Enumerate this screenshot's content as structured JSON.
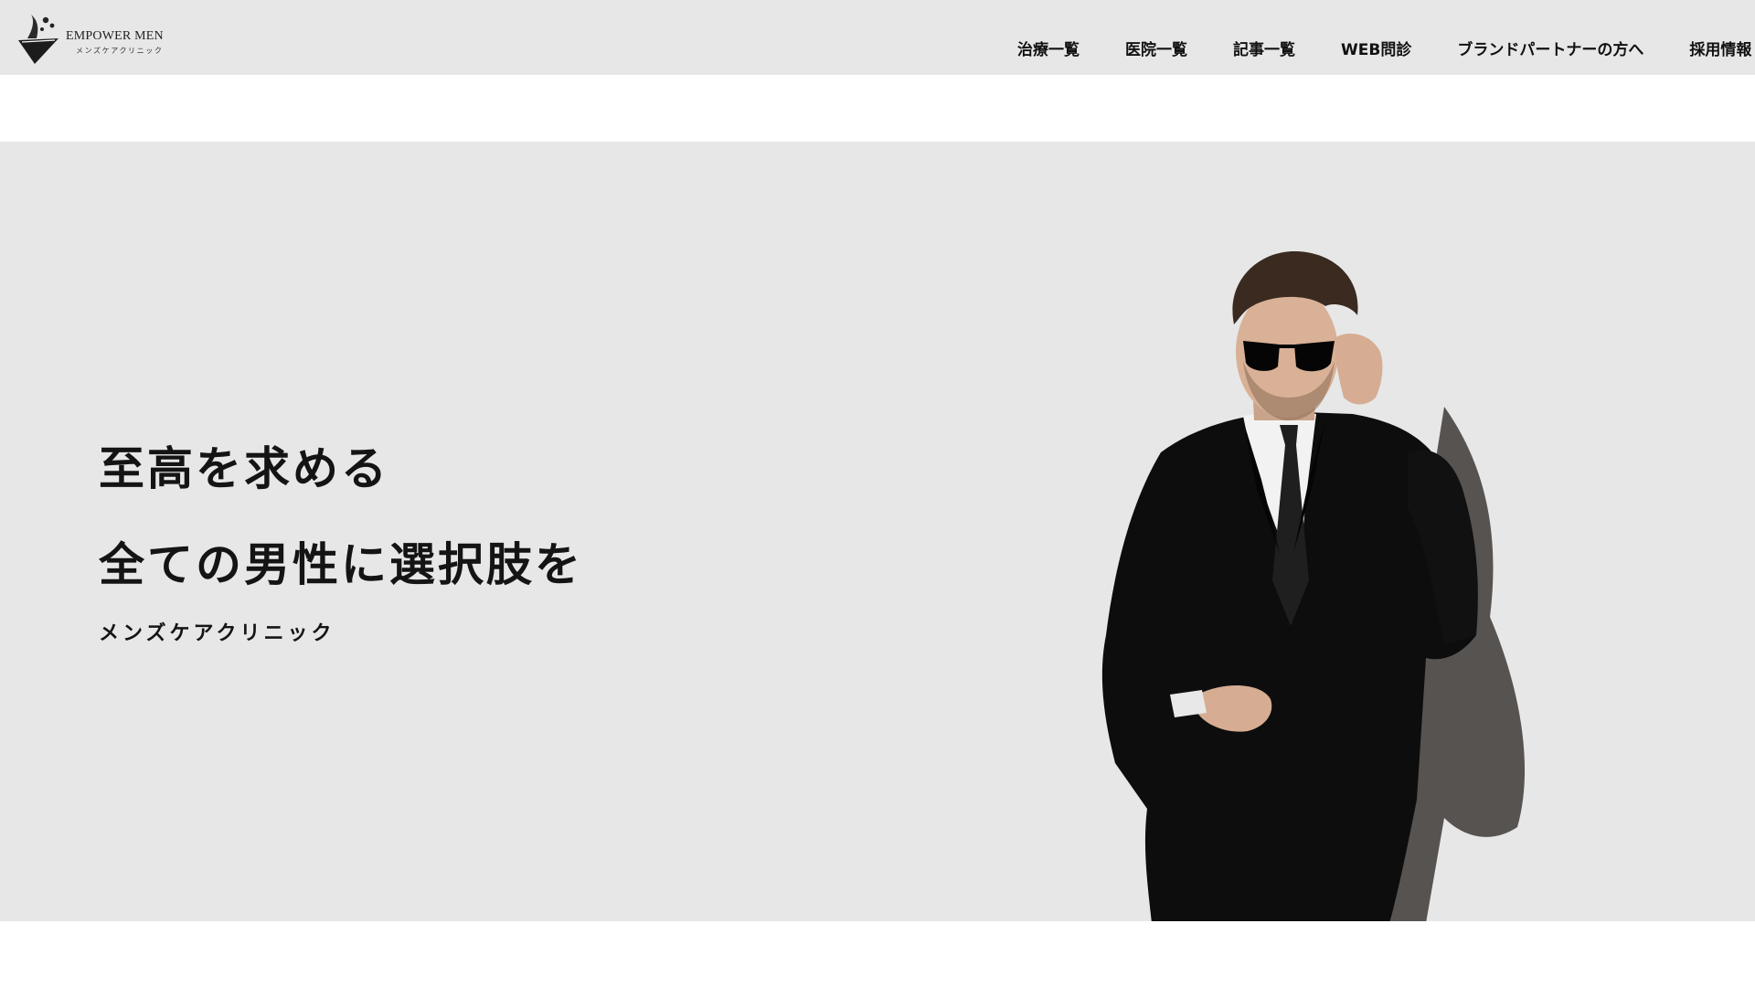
{
  "header": {
    "logo": {
      "name": "EMPOWER MEN",
      "subtitle": "メンズケアクリニック"
    },
    "nav": [
      {
        "label": "治療一覧"
      },
      {
        "label": "医院一覧"
      },
      {
        "label": "記事一覧"
      },
      {
        "label": "WEB問診"
      },
      {
        "label": "ブランドパートナーの方へ"
      },
      {
        "label": "採用情報"
      }
    ]
  },
  "hero": {
    "headline_line1": "至高を求める",
    "headline_line2": "全ての男性に選択肢を",
    "subheading": "メンズケアクリニック",
    "image": "man-in-black-suit-adjusting-sunglasses",
    "background_color": "#e7e7e7"
  },
  "colors": {
    "header_bg": "#e7e7e7",
    "hero_bg": "#e7e7e7",
    "text": "#111111"
  }
}
